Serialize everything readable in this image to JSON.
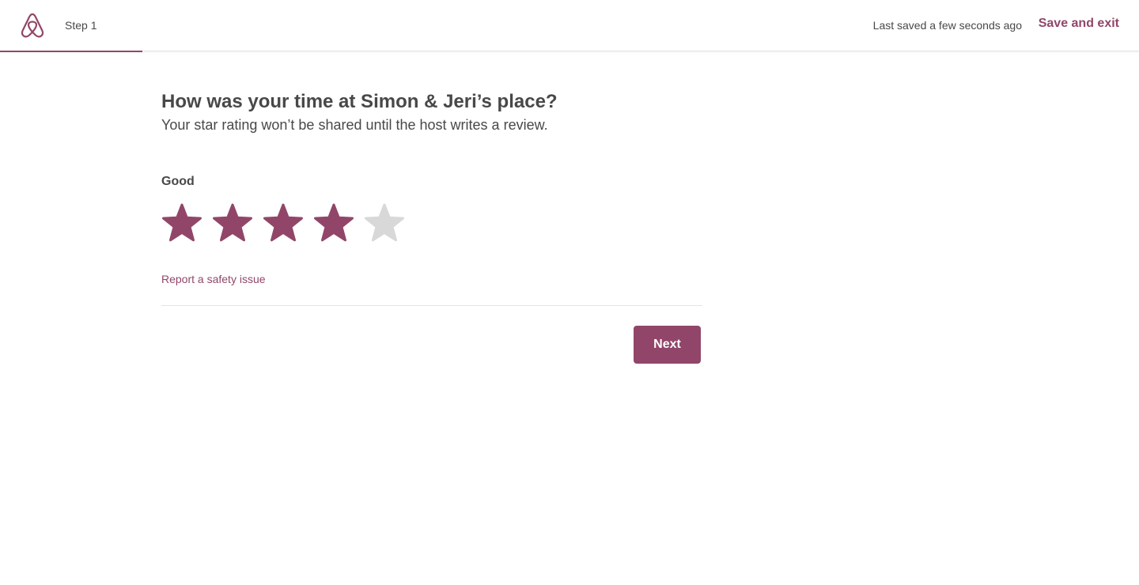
{
  "header": {
    "logo_icon": "airbnb-logo-icon",
    "step_label": "Step 1",
    "progress_fraction": 0.125,
    "saved_status": "Last saved a few seconds ago",
    "save_exit_label": "Save and exit"
  },
  "main": {
    "title": "How was your time at Simon & Jeri’s place?",
    "subtitle": "Your star rating won’t be shared until the host writes a review.",
    "rating_label": "Good",
    "rating": {
      "value": 4,
      "max": 5,
      "star_icon": "star-icon"
    },
    "safety_link": "Report a safety issue",
    "next_label": "Next"
  },
  "colors": {
    "accent": "#914669",
    "star_inactive": "#d8d8d8",
    "text": "#484848",
    "divider": "#e4e4e4"
  }
}
